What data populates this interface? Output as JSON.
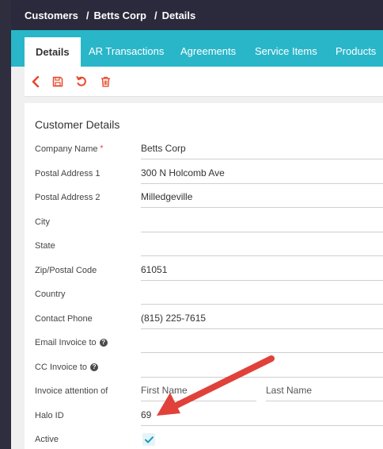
{
  "breadcrumb": {
    "items": [
      "Customers",
      "Betts Corp",
      "Details"
    ],
    "separator": "/"
  },
  "tabs": [
    {
      "label": "Details",
      "active": true
    },
    {
      "label": "AR Transactions",
      "active": false
    },
    {
      "label": "Agreements",
      "active": false
    },
    {
      "label": "Service Items",
      "active": false
    },
    {
      "label": "Products",
      "active": false
    }
  ],
  "toolbar": {
    "icons": [
      "back-icon",
      "save-icon",
      "undo-icon",
      "delete-icon"
    ],
    "accent_color": "#e8492c"
  },
  "form": {
    "title": "Customer Details",
    "fields": {
      "company_name": {
        "label": "Company Name",
        "required_mark": "*",
        "value": "Betts Corp"
      },
      "postal_address_1": {
        "label": "Postal Address 1",
        "value": "300 N Holcomb Ave"
      },
      "postal_address_2": {
        "label": "Postal Address 2",
        "value": "Milledgeville"
      },
      "city": {
        "label": "City",
        "value": ""
      },
      "state": {
        "label": "State",
        "value": ""
      },
      "zip": {
        "label": "Zip/Postal Code",
        "value": "61051"
      },
      "country": {
        "label": "Country",
        "value": ""
      },
      "contact_phone": {
        "label": "Contact Phone",
        "value": "(815) 225-7615"
      },
      "email_invoice_to": {
        "label": "Email Invoice to",
        "help": "?",
        "value": ""
      },
      "cc_invoice_to": {
        "label": "CC Invoice to",
        "help": "?",
        "value": ""
      },
      "invoice_attention_of": {
        "label": "Invoice attention of",
        "first_name": "First Name",
        "last_name": "Last Name"
      },
      "halo_id": {
        "label": "Halo ID",
        "value": "69"
      },
      "active": {
        "label": "Active",
        "checked": true
      }
    }
  },
  "colors": {
    "tab_bar": "#29b6c9",
    "top_bar": "#2a2a3c",
    "annotation_arrow": "#e0413a",
    "checkbox_check": "#1e9bc0"
  }
}
